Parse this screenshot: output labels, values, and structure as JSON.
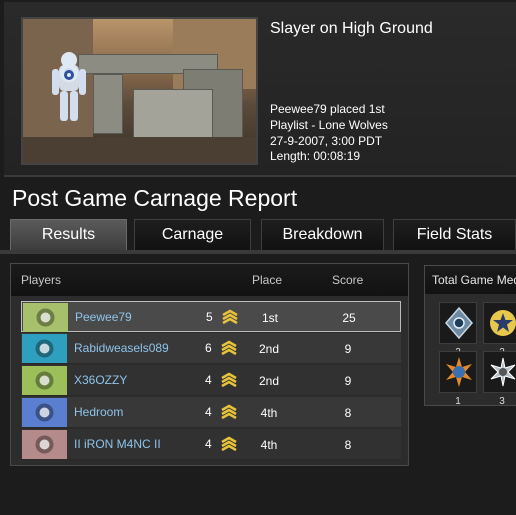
{
  "game": {
    "title": "Slayer on High Ground",
    "placed": "Peewee79 placed 1st",
    "playlist": "Playlist - Lone Wolves",
    "date": "27-9-2007, 3:00 PDT",
    "length": "Length: 00:08:19"
  },
  "report_title": "Post Game Carnage Report",
  "tabs": [
    {
      "label": "Results",
      "active": true
    },
    {
      "label": "Carnage",
      "active": false
    },
    {
      "label": "Breakdown",
      "active": false
    },
    {
      "label": "Field Stats",
      "active": false
    }
  ],
  "results": {
    "columns": {
      "players": "Players",
      "place": "Place",
      "score": "Score"
    },
    "rows": [
      {
        "gamertag": "Peewee79",
        "rank": "5",
        "place": "1st",
        "score": "25",
        "emblem_bg": "#a7c06b",
        "highlighted": true
      },
      {
        "gamertag": "Rabidweasels089",
        "rank": "6",
        "place": "2nd",
        "score": "9",
        "emblem_bg": "#2f9fbf",
        "highlighted": false
      },
      {
        "gamertag": "X36OZZY",
        "rank": "4",
        "place": "2nd",
        "score": "9",
        "emblem_bg": "#9dbf5a",
        "highlighted": false
      },
      {
        "gamertag": "Hedroom",
        "rank": "4",
        "place": "4th",
        "score": "8",
        "emblem_bg": "#5b7fd0",
        "highlighted": false
      },
      {
        "gamertag": "II iRON M4NC II",
        "rank": "4",
        "place": "4th",
        "score": "8",
        "emblem_bg": "#b58a8a",
        "highlighted": false
      }
    ]
  },
  "medals": {
    "title": "Total Game Medals",
    "items": [
      {
        "icon": "diamond-medal-icon",
        "count": "2"
      },
      {
        "icon": "star-medal-icon",
        "count": "2"
      },
      {
        "icon": "burst-medal-icon",
        "count": "1"
      },
      {
        "icon": "spike-medal-icon",
        "count": "3"
      }
    ]
  },
  "colors": {
    "gamertag": "#8ec4ea",
    "rank_chevron": "#e8c23a"
  }
}
